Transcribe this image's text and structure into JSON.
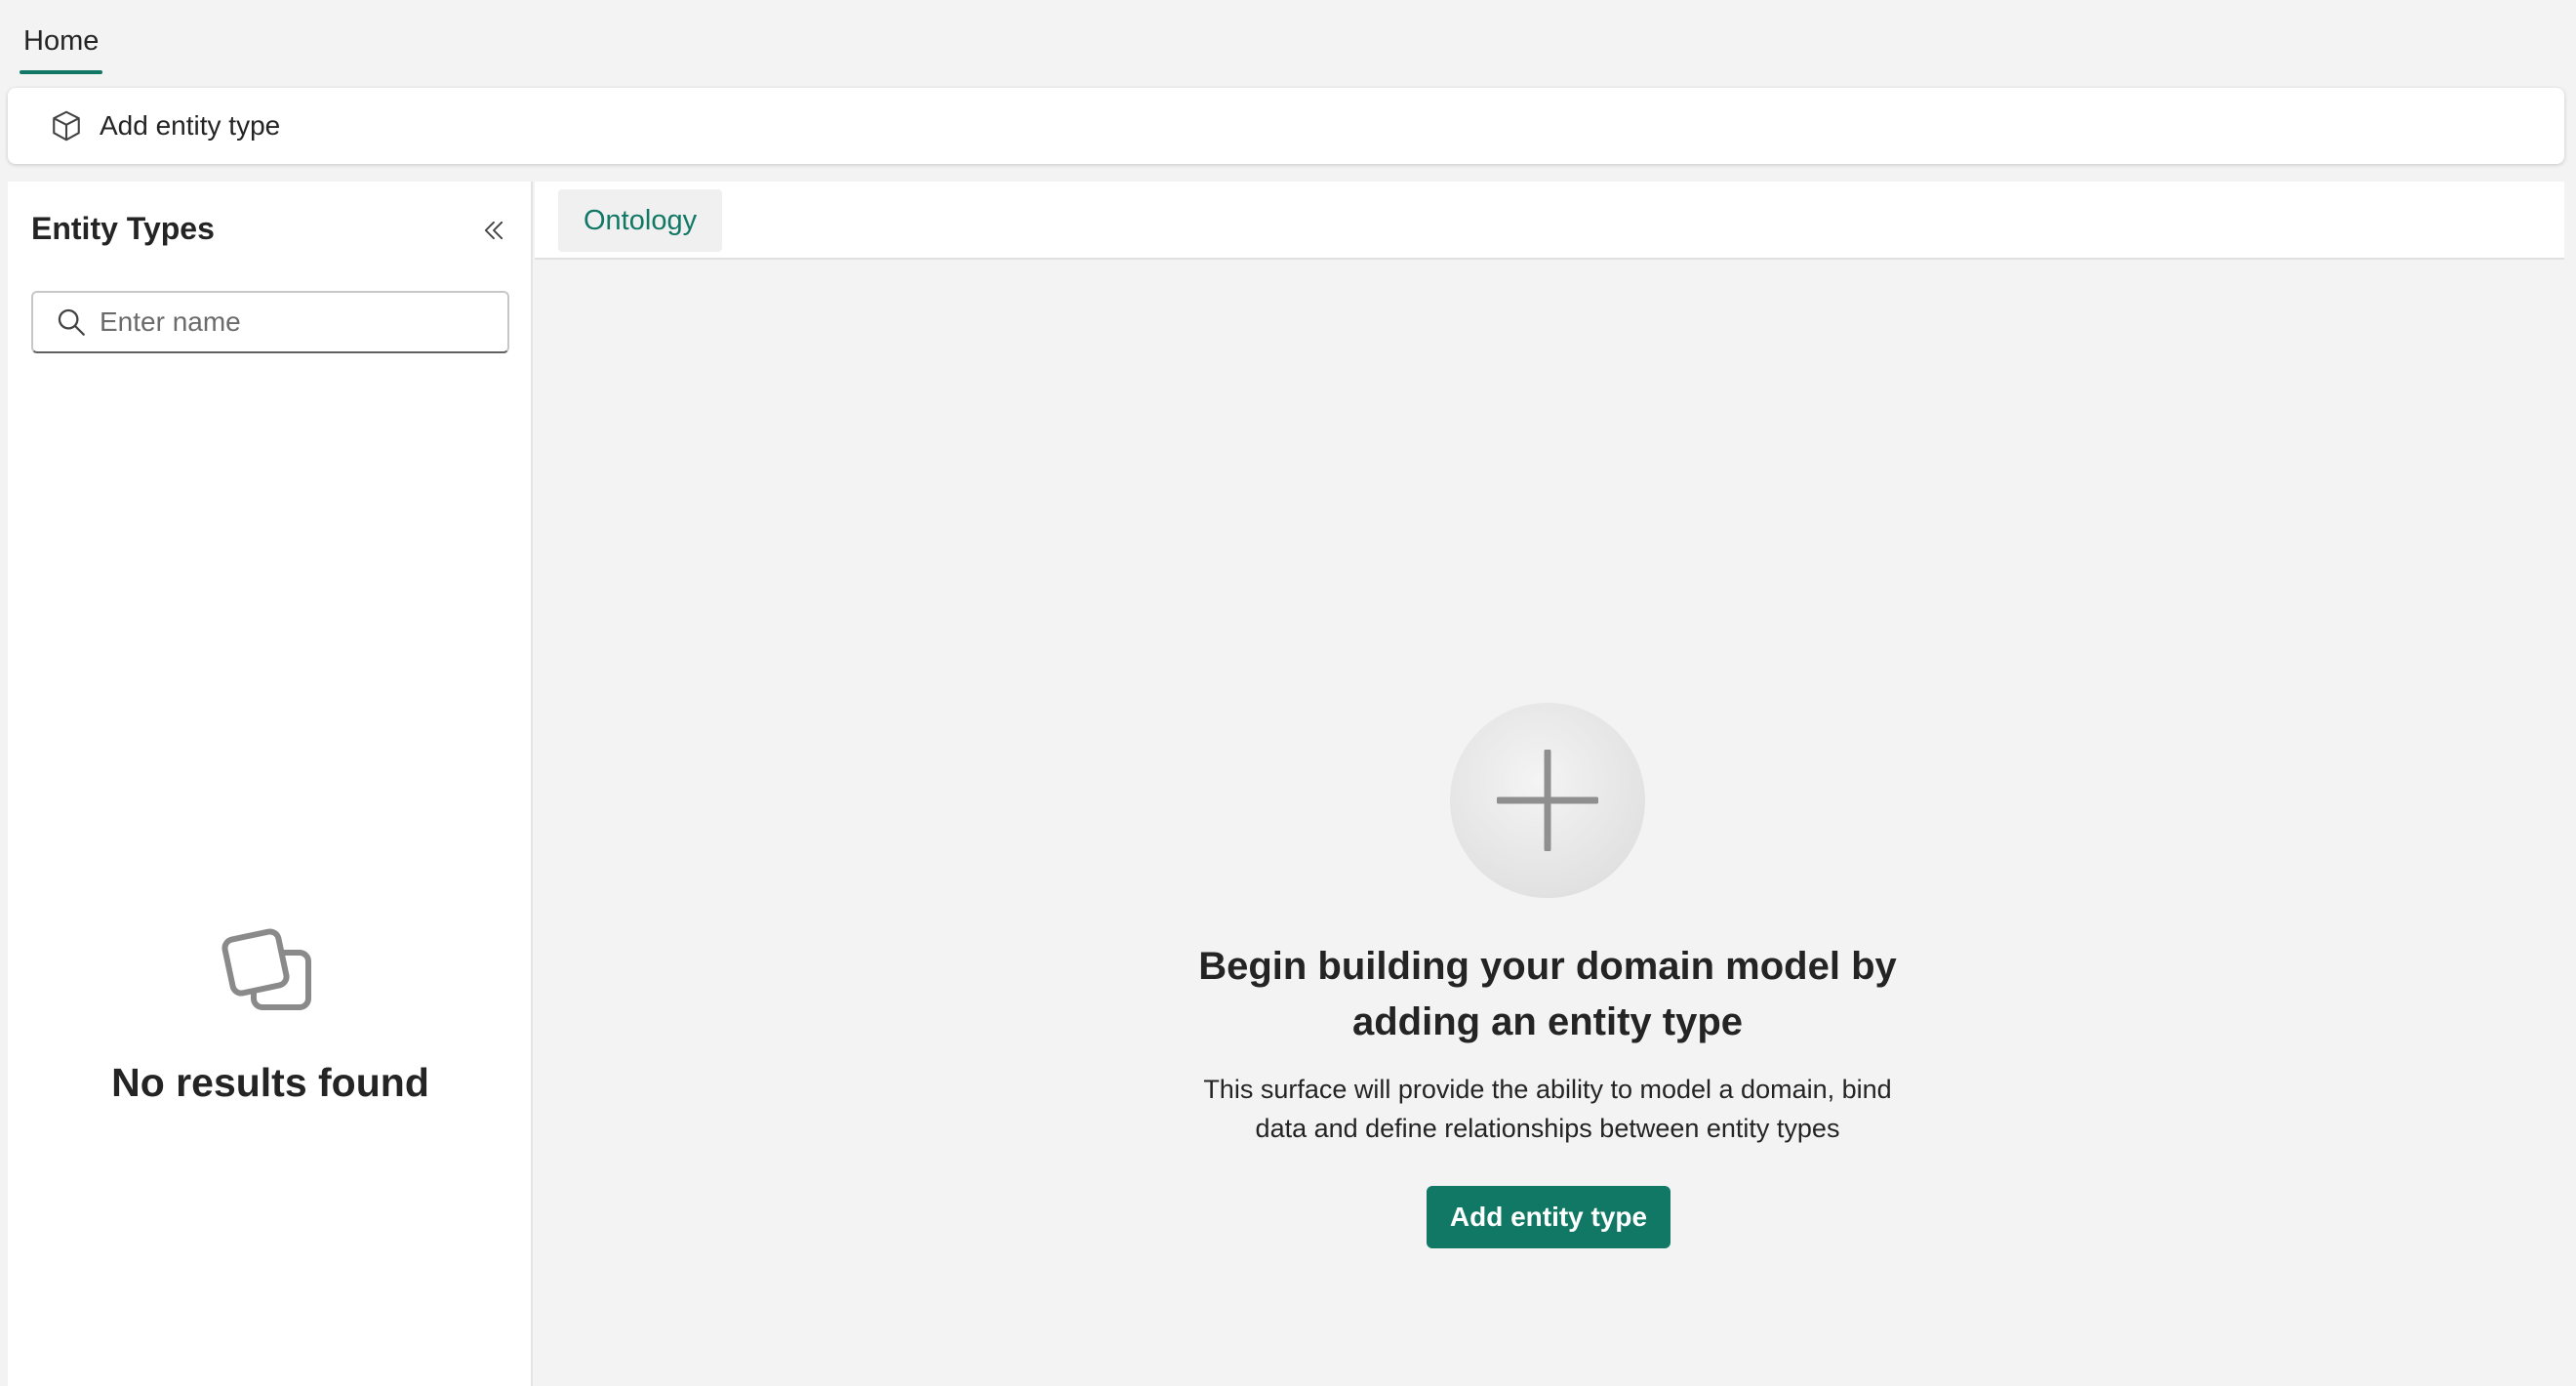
{
  "tabs": {
    "home_label": "Home"
  },
  "ribbon": {
    "add_entity_label": "Add entity type",
    "add_entity_icon": "cube-icon"
  },
  "sidebar": {
    "title": "Entity Types",
    "collapse_icon": "double-chevron-left-icon",
    "search": {
      "placeholder": "Enter name",
      "value": ""
    },
    "empty_state": {
      "icon": "empty-squares-icon",
      "text": "No results found"
    }
  },
  "main": {
    "tab_label": "Ontology",
    "empty_state": {
      "icon": "plus-icon",
      "heading_line1": "Begin building your domain model by",
      "heading_line2": "adding an entity type",
      "description_line1": "This surface will provide the ability to model a domain, bind",
      "description_line2": "data and define relationships between entity types",
      "button_label": "Add entity type"
    }
  },
  "colors": {
    "accent": "#117865",
    "background": "#f3f3f3",
    "surface": "#ffffff"
  }
}
